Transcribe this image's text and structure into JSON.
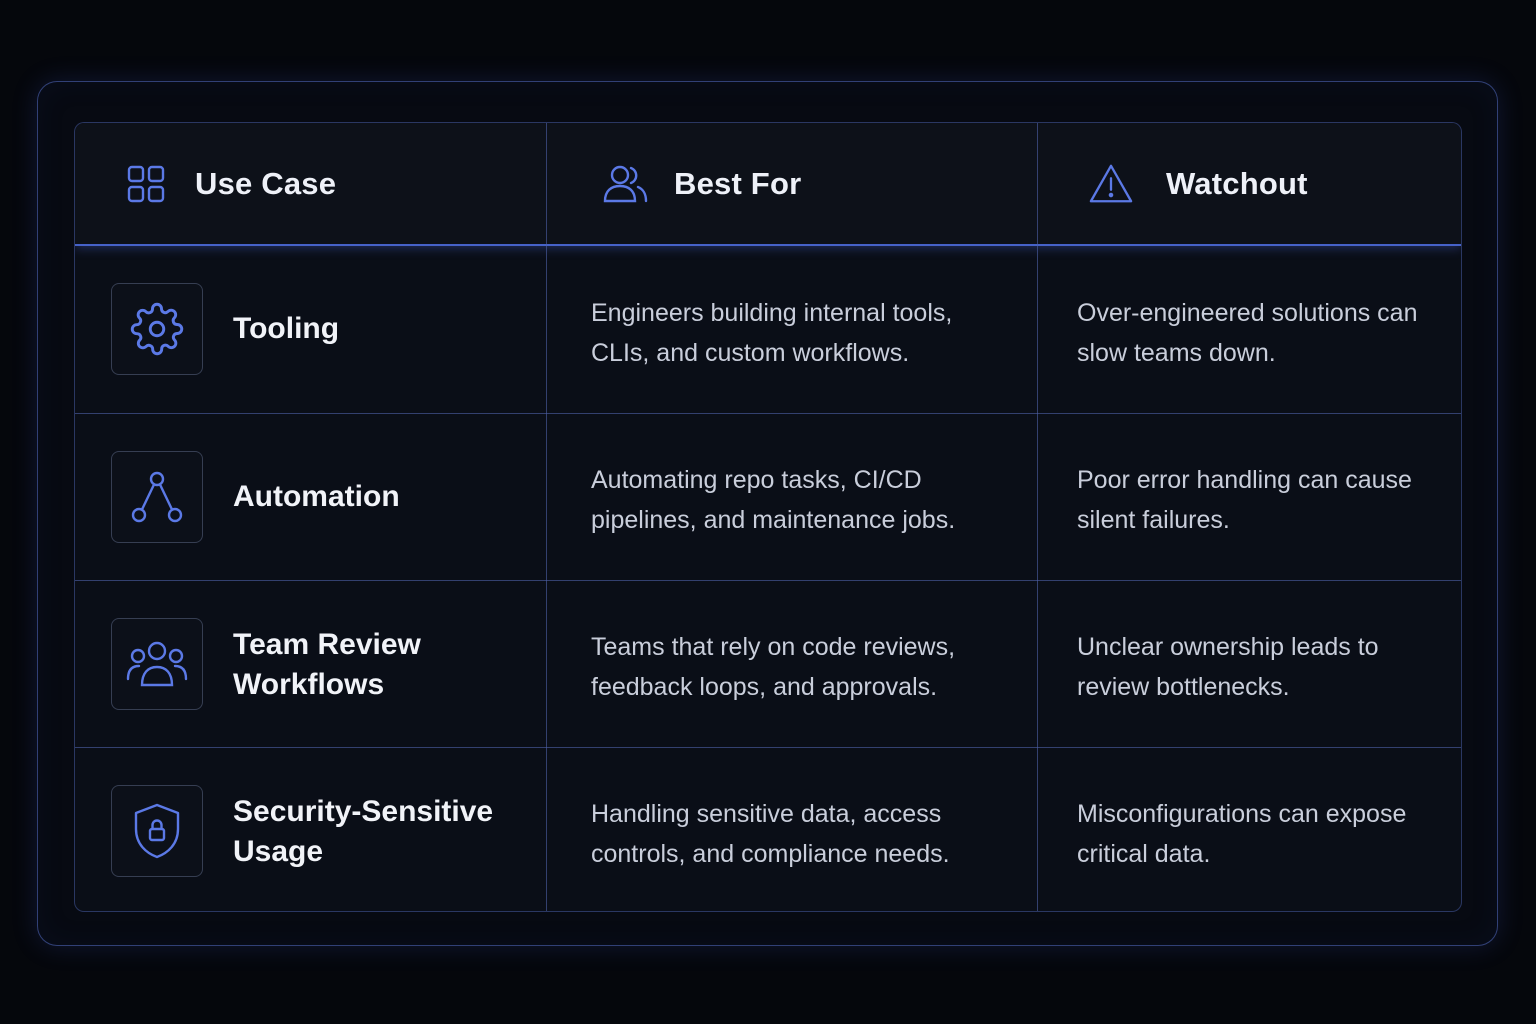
{
  "colors": {
    "accent": "#5b79e6",
    "background": "#05070c",
    "panel": "#0a0e17",
    "heading_text": "#eef1f8",
    "body_text": "#c9cedb"
  },
  "header": {
    "columns": [
      {
        "label": "Use Case",
        "icon": "grid-icon"
      },
      {
        "label": "Best For",
        "icon": "users-icon"
      },
      {
        "label": "Watchout",
        "icon": "warning-icon"
      }
    ]
  },
  "rows": [
    {
      "use_case": "Tooling",
      "icon": "gear-icon",
      "best_for": "Engineers building internal tools,\nCLIs, and custom workflows.",
      "watchout": "Over-engineered solutions can\nslow teams down."
    },
    {
      "use_case": "Automation",
      "icon": "workflow-nodes-icon",
      "best_for": "Automating repo tasks, CI/CD\npipelines, and maintenance jobs.",
      "watchout": "Poor error handling can cause\nsilent failures."
    },
    {
      "use_case": "Team Review Workflows",
      "icon": "team-icon",
      "best_for": "Teams that rely on code reviews,\nfeedback loops, and approvals.",
      "watchout": "Unclear ownership leads to\nreview bottlenecks."
    },
    {
      "use_case": "Security-Sensitive Usage",
      "icon": "shield-lock-icon",
      "best_for": "Handling sensitive data, access\ncontrols, and compliance needs.",
      "watchout": "Misconfigurations can expose\ncritical data."
    }
  ]
}
